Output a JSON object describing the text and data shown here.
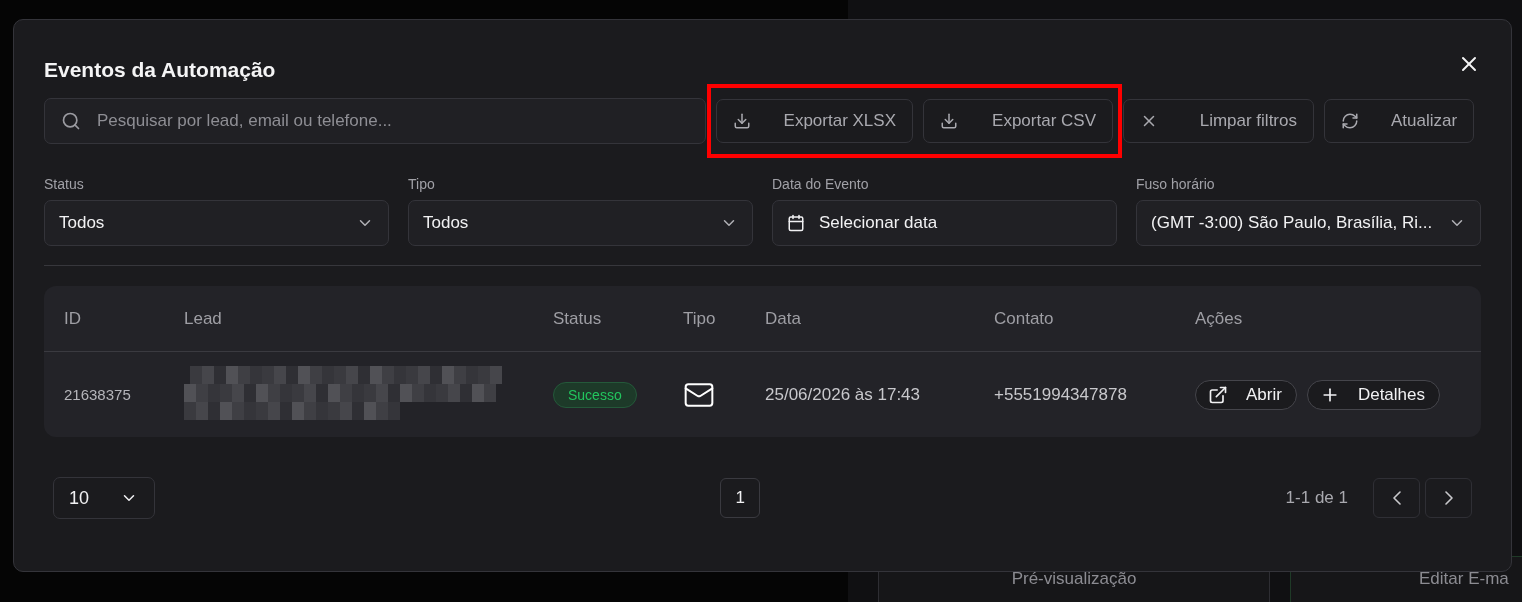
{
  "background": {
    "cards": [
      {
        "title": "Pré-visualização"
      },
      {
        "title": "Editar E-ma"
      }
    ]
  },
  "dialog": {
    "title": "Eventos da Automação",
    "search": {
      "placeholder": "Pesquisar por lead, email ou telefone..."
    },
    "actions": [
      {
        "kind": "download",
        "label": "Exportar XLSX",
        "highlighted": true
      },
      {
        "kind": "download",
        "label": "Exportar CSV",
        "highlighted": true
      },
      {
        "kind": "clear",
        "label": "Limpar filtros",
        "highlighted": false
      },
      {
        "kind": "refresh",
        "label": "Atualizar",
        "highlighted": false
      }
    ],
    "filters": [
      {
        "kind": "select",
        "label": "Status",
        "value": "Todos"
      },
      {
        "kind": "select",
        "label": "Tipo",
        "value": "Todos"
      },
      {
        "kind": "date",
        "label": "Data do Evento",
        "value": "Selecionar data"
      },
      {
        "kind": "select",
        "label": "Fuso horário",
        "value": "(GMT -3:00) São Paulo, Brasília, Ri..."
      }
    ],
    "table": {
      "columns": [
        "ID",
        "Lead",
        "Status",
        "Tipo",
        "Data",
        "Contato",
        "Ações"
      ],
      "rows": [
        {
          "id": "21638375",
          "lead": {
            "kind": "redacted"
          },
          "status": {
            "label": "Sucesso",
            "color": "#22c55e"
          },
          "kind": "email",
          "date": "25/06/2026 às 17:43",
          "contact": "+5551994347878",
          "actions": [
            {
              "kind": "open",
              "label": "Abrir"
            },
            {
              "kind": "details",
              "label": "Detalhes"
            }
          ]
        }
      ]
    },
    "pagination": {
      "page_size": "10",
      "pages": [
        "1"
      ],
      "range": "1-1 de 1"
    }
  }
}
